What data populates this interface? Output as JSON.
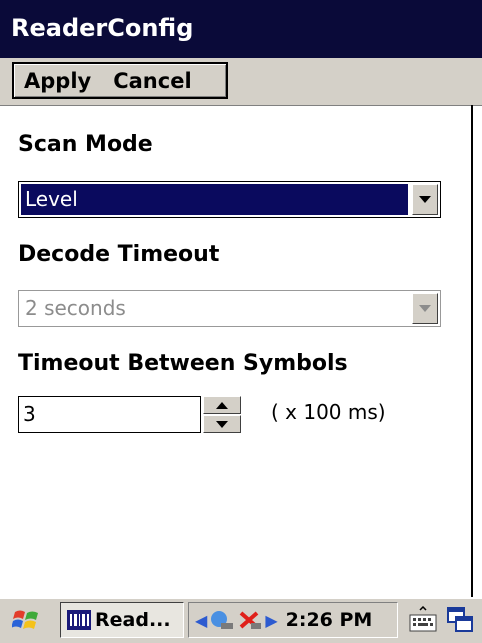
{
  "window": {
    "title": "ReaderConfig"
  },
  "menu": {
    "apply_label": "Apply",
    "cancel_label": "Cancel"
  },
  "scan_mode": {
    "label": "Scan Mode",
    "value": "Level"
  },
  "decode_timeout": {
    "label": "Decode Timeout",
    "value": "2 seconds"
  },
  "timeout_between": {
    "label": "Timeout Between Symbols",
    "value": "3",
    "unit": "( x 100 ms)"
  },
  "taskbar": {
    "task_label": "Read...",
    "clock": "2:26 PM",
    "icons": [
      "start-flag-icon",
      "app-icon",
      "network-icon",
      "warning-icon",
      "keyboard-icon",
      "windows-icon"
    ]
  },
  "colors": {
    "titlebar": "#0a0a39",
    "selection": "#0a0a5e",
    "chrome": "#d4d0c8"
  }
}
